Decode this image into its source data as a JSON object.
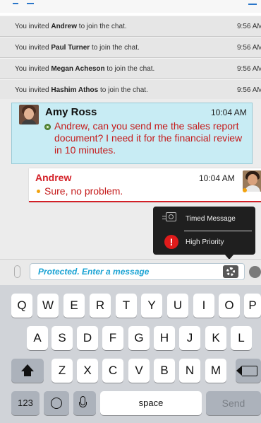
{
  "system_messages": [
    {
      "prefix": "You invited ",
      "name": "Andrew",
      "suffix": " to join the chat.",
      "time": "9:56 AM"
    },
    {
      "prefix": "You invited ",
      "name": "Paul Turner",
      "suffix": " to join the chat.",
      "time": "9:56 AM"
    },
    {
      "prefix": "You invited ",
      "name": "Megan Acheson",
      "suffix": " to join the chat.",
      "time": "9:56 AM"
    },
    {
      "prefix": "You invited ",
      "name": "Hashim Athos",
      "suffix": " to join the chat.",
      "time": "9:56 AM"
    }
  ],
  "incoming": {
    "sender": "Amy Ross",
    "time": "10:04 AM",
    "text": "Andrew, can you send me the sales report document?  I need it for the financial review in 10 minutes.",
    "status_color": "#5c8f3c"
  },
  "outgoing": {
    "sender": "Andrew",
    "time": "10:04 AM",
    "text": "Sure, no problem.",
    "status_color": "#f2a30f"
  },
  "popup": {
    "timed_label": "Timed Message",
    "priority_label": "High Priority",
    "priority_glyph": "!"
  },
  "composer": {
    "placeholder": "Protected. Enter a message"
  },
  "keyboard": {
    "row1": [
      "Q",
      "W",
      "E",
      "R",
      "T",
      "Y",
      "U",
      "I",
      "O",
      "P"
    ],
    "row2": [
      "A",
      "S",
      "D",
      "F",
      "G",
      "H",
      "J",
      "K",
      "L"
    ],
    "row3": [
      "Z",
      "X",
      "C",
      "V",
      "B",
      "N",
      "M"
    ],
    "numbers_label": "123",
    "space_label": "space",
    "send_label": "Send"
  },
  "colors": {
    "accent_blue": "#1aa3d4",
    "alert_red": "#d31f26",
    "incoming_bg": "#c8ecf4"
  }
}
